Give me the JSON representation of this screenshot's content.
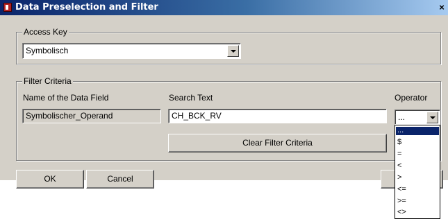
{
  "window": {
    "title": "Data Preselection and Filter",
    "close_glyph": "×"
  },
  "access_key": {
    "legend": "Access Key",
    "selected": "Symbolisch"
  },
  "filter": {
    "legend": "Filter Criteria",
    "col_name": "Name of the Data Field",
    "col_search": "Search Text",
    "col_operator": "Operator",
    "field_name": "Symbolischer_Operand",
    "search_text": "CH_BCK_RV",
    "operator_selected": "...",
    "clear_button": "Clear Filter Criteria"
  },
  "buttons": {
    "ok": "OK",
    "cancel": "Cancel"
  },
  "operator_options": [
    "...",
    "$",
    "=",
    "<",
    ">",
    "<=",
    ">=",
    "<>"
  ],
  "colors": {
    "title_start": "#0a246a",
    "title_end": "#a6caf0",
    "face": "#d4d0c8",
    "highlight": "#0a246a"
  }
}
